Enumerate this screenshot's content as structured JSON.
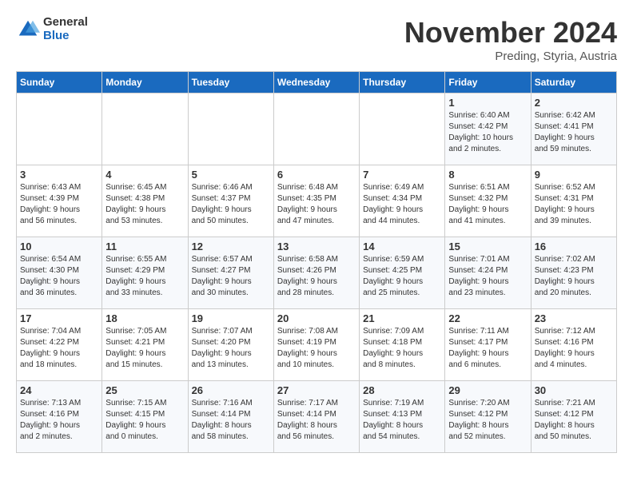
{
  "logo": {
    "general": "General",
    "blue": "Blue"
  },
  "title": "November 2024",
  "location": "Preding, Styria, Austria",
  "weekdays": [
    "Sunday",
    "Monday",
    "Tuesday",
    "Wednesday",
    "Thursday",
    "Friday",
    "Saturday"
  ],
  "weeks": [
    [
      {
        "day": "",
        "info": ""
      },
      {
        "day": "",
        "info": ""
      },
      {
        "day": "",
        "info": ""
      },
      {
        "day": "",
        "info": ""
      },
      {
        "day": "",
        "info": ""
      },
      {
        "day": "1",
        "info": "Sunrise: 6:40 AM\nSunset: 4:42 PM\nDaylight: 10 hours\nand 2 minutes."
      },
      {
        "day": "2",
        "info": "Sunrise: 6:42 AM\nSunset: 4:41 PM\nDaylight: 9 hours\nand 59 minutes."
      }
    ],
    [
      {
        "day": "3",
        "info": "Sunrise: 6:43 AM\nSunset: 4:39 PM\nDaylight: 9 hours\nand 56 minutes."
      },
      {
        "day": "4",
        "info": "Sunrise: 6:45 AM\nSunset: 4:38 PM\nDaylight: 9 hours\nand 53 minutes."
      },
      {
        "day": "5",
        "info": "Sunrise: 6:46 AM\nSunset: 4:37 PM\nDaylight: 9 hours\nand 50 minutes."
      },
      {
        "day": "6",
        "info": "Sunrise: 6:48 AM\nSunset: 4:35 PM\nDaylight: 9 hours\nand 47 minutes."
      },
      {
        "day": "7",
        "info": "Sunrise: 6:49 AM\nSunset: 4:34 PM\nDaylight: 9 hours\nand 44 minutes."
      },
      {
        "day": "8",
        "info": "Sunrise: 6:51 AM\nSunset: 4:32 PM\nDaylight: 9 hours\nand 41 minutes."
      },
      {
        "day": "9",
        "info": "Sunrise: 6:52 AM\nSunset: 4:31 PM\nDaylight: 9 hours\nand 39 minutes."
      }
    ],
    [
      {
        "day": "10",
        "info": "Sunrise: 6:54 AM\nSunset: 4:30 PM\nDaylight: 9 hours\nand 36 minutes."
      },
      {
        "day": "11",
        "info": "Sunrise: 6:55 AM\nSunset: 4:29 PM\nDaylight: 9 hours\nand 33 minutes."
      },
      {
        "day": "12",
        "info": "Sunrise: 6:57 AM\nSunset: 4:27 PM\nDaylight: 9 hours\nand 30 minutes."
      },
      {
        "day": "13",
        "info": "Sunrise: 6:58 AM\nSunset: 4:26 PM\nDaylight: 9 hours\nand 28 minutes."
      },
      {
        "day": "14",
        "info": "Sunrise: 6:59 AM\nSunset: 4:25 PM\nDaylight: 9 hours\nand 25 minutes."
      },
      {
        "day": "15",
        "info": "Sunrise: 7:01 AM\nSunset: 4:24 PM\nDaylight: 9 hours\nand 23 minutes."
      },
      {
        "day": "16",
        "info": "Sunrise: 7:02 AM\nSunset: 4:23 PM\nDaylight: 9 hours\nand 20 minutes."
      }
    ],
    [
      {
        "day": "17",
        "info": "Sunrise: 7:04 AM\nSunset: 4:22 PM\nDaylight: 9 hours\nand 18 minutes."
      },
      {
        "day": "18",
        "info": "Sunrise: 7:05 AM\nSunset: 4:21 PM\nDaylight: 9 hours\nand 15 minutes."
      },
      {
        "day": "19",
        "info": "Sunrise: 7:07 AM\nSunset: 4:20 PM\nDaylight: 9 hours\nand 13 minutes."
      },
      {
        "day": "20",
        "info": "Sunrise: 7:08 AM\nSunset: 4:19 PM\nDaylight: 9 hours\nand 10 minutes."
      },
      {
        "day": "21",
        "info": "Sunrise: 7:09 AM\nSunset: 4:18 PM\nDaylight: 9 hours\nand 8 minutes."
      },
      {
        "day": "22",
        "info": "Sunrise: 7:11 AM\nSunset: 4:17 PM\nDaylight: 9 hours\nand 6 minutes."
      },
      {
        "day": "23",
        "info": "Sunrise: 7:12 AM\nSunset: 4:16 PM\nDaylight: 9 hours\nand 4 minutes."
      }
    ],
    [
      {
        "day": "24",
        "info": "Sunrise: 7:13 AM\nSunset: 4:16 PM\nDaylight: 9 hours\nand 2 minutes."
      },
      {
        "day": "25",
        "info": "Sunrise: 7:15 AM\nSunset: 4:15 PM\nDaylight: 9 hours\nand 0 minutes."
      },
      {
        "day": "26",
        "info": "Sunrise: 7:16 AM\nSunset: 4:14 PM\nDaylight: 8 hours\nand 58 minutes."
      },
      {
        "day": "27",
        "info": "Sunrise: 7:17 AM\nSunset: 4:14 PM\nDaylight: 8 hours\nand 56 minutes."
      },
      {
        "day": "28",
        "info": "Sunrise: 7:19 AM\nSunset: 4:13 PM\nDaylight: 8 hours\nand 54 minutes."
      },
      {
        "day": "29",
        "info": "Sunrise: 7:20 AM\nSunset: 4:12 PM\nDaylight: 8 hours\nand 52 minutes."
      },
      {
        "day": "30",
        "info": "Sunrise: 7:21 AM\nSunset: 4:12 PM\nDaylight: 8 hours\nand 50 minutes."
      }
    ]
  ]
}
